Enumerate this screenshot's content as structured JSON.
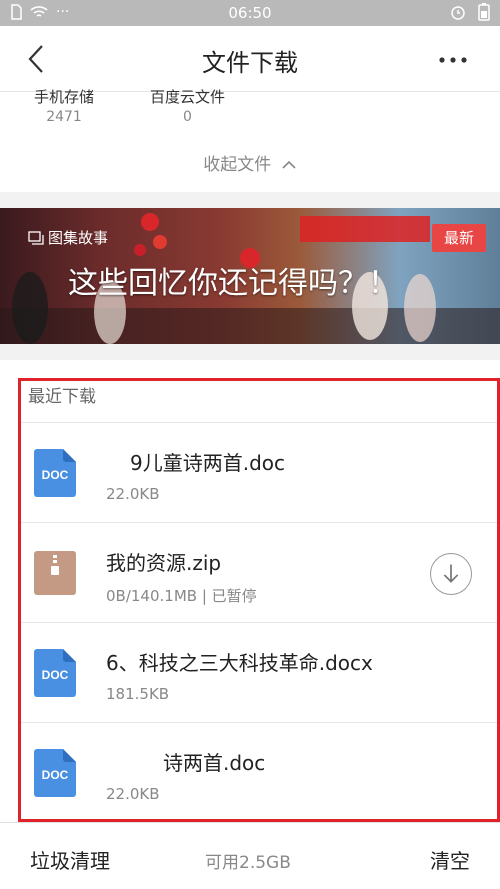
{
  "status_bar": {
    "time": "06:50",
    "left_dots": "···"
  },
  "header": {
    "title": "文件下载"
  },
  "storage": {
    "phone": {
      "label": "手机存储",
      "count": "2471"
    },
    "cloud": {
      "label": "百度云文件",
      "count": "0"
    },
    "collapse_label": "收起文件"
  },
  "banner": {
    "tag": "图集故事",
    "headline": "这些回忆你还记得吗？！",
    "badge": "最新"
  },
  "recent": {
    "header": "最近下载",
    "items": [
      {
        "name": "9儿童诗两首.doc",
        "meta": "22.0KB",
        "icon": "doc-file-icon",
        "icon_text": "DOC"
      },
      {
        "name": "我的资源.zip",
        "meta": "0B/140.1MB | 已暂停",
        "icon": "zip-file-icon"
      },
      {
        "name": "6、科技之三大科技革命.docx",
        "meta": "181.5KB",
        "icon": "doc-file-icon",
        "icon_text": "DOC"
      },
      {
        "name": "诗两首.doc",
        "meta": "22.0KB",
        "icon": "doc-file-icon",
        "icon_text": "DOC"
      }
    ]
  },
  "footer": {
    "junk_label": "垃圾清理",
    "available": "可用2.5GB",
    "clear_label": "清空"
  },
  "colors": {
    "doc_blue": "#4a90e2",
    "zip_brown": "#c49a84",
    "badge_red": "#e84545",
    "highlight_red": "#e0222a"
  }
}
